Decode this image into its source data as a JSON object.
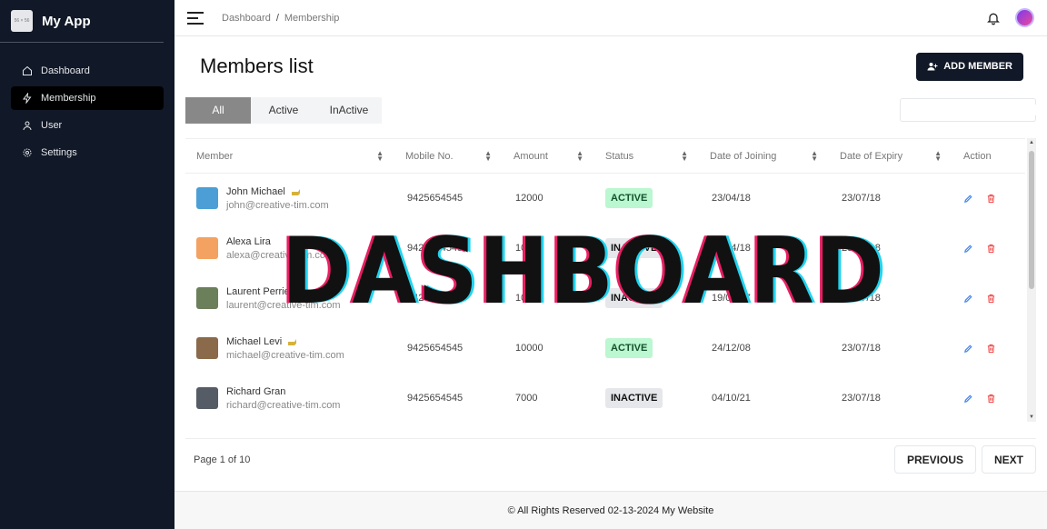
{
  "app": {
    "name": "My App",
    "logo_text": "56 × 56"
  },
  "sidebar": {
    "items": [
      {
        "label": "Dashboard",
        "icon": "home-icon"
      },
      {
        "label": "Membership",
        "icon": "bolt-icon",
        "active": true
      },
      {
        "label": "User",
        "icon": "user-icon"
      },
      {
        "label": "Settings",
        "icon": "gear-icon"
      }
    ]
  },
  "header": {
    "breadcrumb": [
      "Dashboard",
      "Membership"
    ],
    "separator": "/"
  },
  "main": {
    "title": "Members list",
    "add_button": "ADD MEMBER",
    "tabs": [
      "All",
      "Active",
      "InActive"
    ],
    "search_placeholder": ""
  },
  "table": {
    "columns": [
      "Member",
      "Mobile No.",
      "Amount",
      "Status",
      "Date of Joining",
      "Date of Expiry",
      "Action"
    ],
    "rows": [
      {
        "name": "John Michael",
        "email": "john@creative-tim.com",
        "mobile": "9425654545",
        "amount": "12000",
        "status": "ACTIVE",
        "joined": "23/04/18",
        "expiry": "23/07/18",
        "badge_icon": true,
        "avatar_color": "#4b9fd6"
      },
      {
        "name": "Alexa Lira",
        "email": "alexa@creative-tim.com",
        "mobile": "9425654545",
        "amount": "10000",
        "status": "INACTIVE",
        "joined": "23/04/18",
        "expiry": "23/07/18",
        "badge_icon": false,
        "avatar_color": "#f4a261"
      },
      {
        "name": "Laurent Perrier",
        "email": "laurent@creative-tim.com",
        "mobile": "9425654545",
        "amount": "10000",
        "status": "INACTIVE",
        "joined": "19/09/17",
        "expiry": "23/07/18",
        "badge_icon": false,
        "avatar_color": "#6b7f5a"
      },
      {
        "name": "Michael Levi",
        "email": "michael@creative-tim.com",
        "mobile": "9425654545",
        "amount": "10000",
        "status": "ACTIVE",
        "joined": "24/12/08",
        "expiry": "23/07/18",
        "badge_icon": true,
        "avatar_color": "#8a6a4a"
      },
      {
        "name": "Richard Gran",
        "email": "richard@creative-tim.com",
        "mobile": "9425654545",
        "amount": "7000",
        "status": "INACTIVE",
        "joined": "04/10/21",
        "expiry": "23/07/18",
        "badge_icon": false,
        "avatar_color": "#555c66"
      }
    ]
  },
  "overlay": {
    "text": "DASHBOARD"
  },
  "pager": {
    "info": "Page 1 of 10",
    "previous": "PREVIOUS",
    "next": "NEXT"
  },
  "footer": {
    "text": "© All Rights Reserved 02-13-2024 My Website"
  },
  "colors": {
    "sidebar_bg": "#111827",
    "active_badge": "#bbf7d0",
    "inactive_badge": "#e5e7eb",
    "edit_icon": "#3b82f6",
    "delete_icon": "#ef4444"
  }
}
